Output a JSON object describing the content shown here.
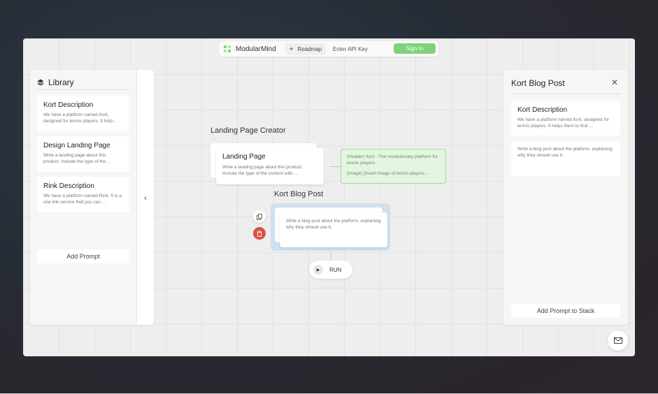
{
  "header": {
    "brand_name": "ModularMind",
    "roadmap_label": "Roadmap",
    "api_key_label": "Enter API Key",
    "signin_label": "Sign In"
  },
  "library": {
    "title": "Library",
    "items": [
      {
        "title": "Kort Description",
        "desc": "We have a platform named Kort, designed for tennis players. It help..."
      },
      {
        "title": "Design Landing Page",
        "desc": "Write a landing page about this product. Include the type of the ..."
      },
      {
        "title": "Rink Description",
        "desc": "We have a platform named Rink. It is a one link service that you can ..."
      }
    ],
    "add_prompt_label": "Add Prompt"
  },
  "canvas": {
    "group1": {
      "label": "Landing Page Creator",
      "node_title": "Landing Page",
      "node_desc": "Write a landing page about this product. Include the type of the content with ...",
      "output_line1": "(Header) Kort - The revolutionary platform for tennis players",
      "output_line2": "(Image) [Insert image of tennis players ..."
    },
    "group2": {
      "label": "Kort Blog Post",
      "node_desc": "Write a blog post about the platform, explaining why they should use it."
    },
    "run_label": "RUN"
  },
  "right_panel": {
    "title": "Kort Blog Post",
    "cards": [
      {
        "title": "Kort Description",
        "desc": "We have a platform named Kort, designed for tennis players. It helps them to find ..."
      },
      {
        "title": "",
        "desc": "Write a blog post about the platform, explaining why they should use it."
      }
    ],
    "add_label": "Add Prompt to Stack"
  },
  "colors": {
    "accent_green": "#7fd27a",
    "delete_red": "#d9533f",
    "selected_blue": "#cfe0ef"
  },
  "icons": [
    "brand-logo-icon",
    "sparkle-icon",
    "layers-icon",
    "chevron-left-icon",
    "close-icon",
    "copy-icon",
    "trash-icon",
    "play-icon",
    "mail-icon"
  ]
}
